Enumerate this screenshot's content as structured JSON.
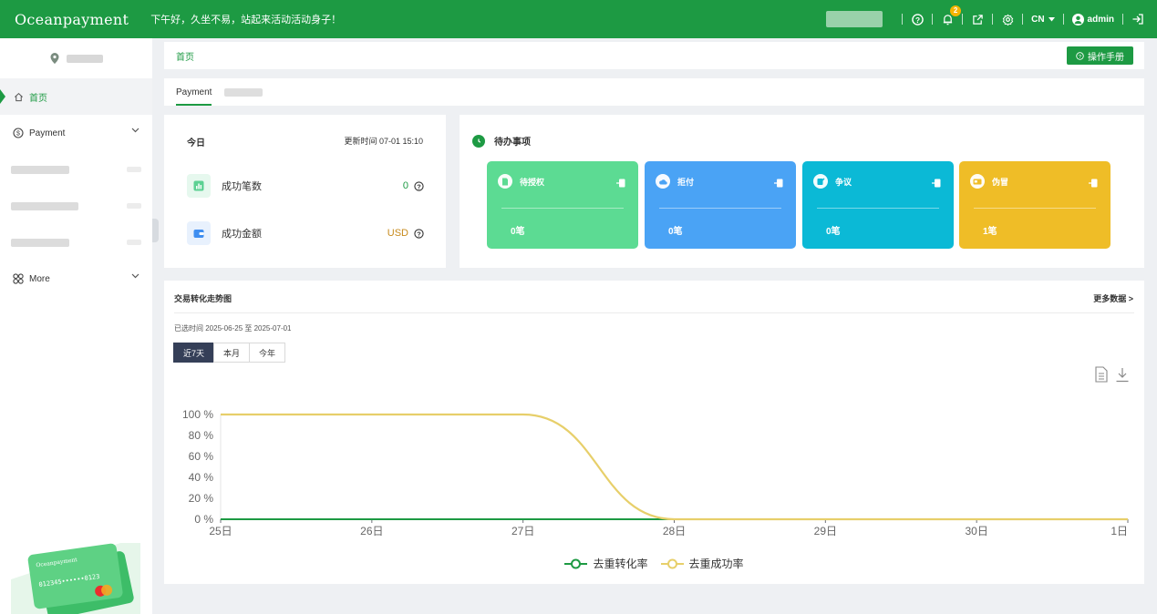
{
  "topbar": {
    "logo": "Oceanpayment",
    "slogan": "下午好，久坐不易，站起来活动活动身子！",
    "notification_count": "2",
    "language": "CN",
    "user_name": "admin"
  },
  "sidebar": {
    "items": [
      {
        "label": "首页",
        "icon": "home-icon",
        "active": true
      },
      {
        "label": "Payment",
        "icon": "payment-icon"
      },
      {
        "label": "More",
        "icon": "grid-icon"
      }
    ]
  },
  "breadcrumb": {
    "home": "首页",
    "manual_button": "操作手册"
  },
  "tabs": [
    {
      "label": "Payment"
    }
  ],
  "today": {
    "title": "今日",
    "update_time": "更新时间 07-01 15:10",
    "stats": [
      {
        "label": "成功笔数",
        "value": "0",
        "icon": "bar-chart-icon"
      },
      {
        "label": "成功金额",
        "value": "USD",
        "icon": "wallet-icon"
      }
    ]
  },
  "todo": {
    "title": "待办事项",
    "tiles": [
      {
        "label": "待授权",
        "value": "0笔",
        "color": "#5cdb93",
        "icon": "document-icon"
      },
      {
        "label": "拒付",
        "value": "0笔",
        "color": "#4aa3f5",
        "icon": "cloud-icon"
      },
      {
        "label": "争议",
        "value": "0笔",
        "color": "#0bb9d6",
        "icon": "edit-icon"
      },
      {
        "label": "伪冒",
        "value": "1笔",
        "color": "#efbd27",
        "icon": "card-icon"
      }
    ]
  },
  "trend": {
    "title": "交易转化走势图",
    "more_label": "更多数据 >",
    "range_text": "已选时间 2025-06-25 至 2025-07-01",
    "ranges": [
      "近7天",
      "本月",
      "今年"
    ],
    "active_range": 0
  },
  "chart_data": {
    "type": "line",
    "categories": [
      "25日",
      "26日",
      "27日",
      "28日",
      "29日",
      "30日",
      "1日"
    ],
    "y_ticks": [
      "0 %",
      "20 %",
      "40 %",
      "60 %",
      "80 %",
      "100 %"
    ],
    "ylim": [
      0,
      100
    ],
    "series": [
      {
        "name": "去重转化率",
        "values": [
          0,
          0,
          0,
          0,
          0,
          0,
          0
        ],
        "color": "#1d9a43"
      },
      {
        "name": "去重成功率",
        "values": [
          100,
          100,
          100,
          0,
          0,
          0,
          0
        ],
        "color": "#e7cf6a"
      }
    ],
    "legend": "bottom"
  }
}
